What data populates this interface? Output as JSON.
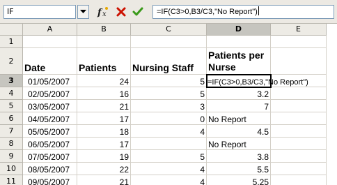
{
  "formula_bar": {
    "name_box": "IF",
    "formula": "=IF(C3>0,B3/C3,\"No Report\")"
  },
  "icons": {
    "fx": "function-wizard-icon",
    "cancel": "cancel-icon",
    "accept": "accept-icon",
    "dropdown": "chevron-down-icon"
  },
  "colors": {
    "header_bg": "#edebe5",
    "header_active_bg": "#c6c5bf",
    "cancel_red": "#cc1100",
    "accept_green": "#3a9a1a"
  },
  "columns": [
    "A",
    "B",
    "C",
    "D",
    "E"
  ],
  "rows": [
    {
      "num": "1",
      "a": "",
      "b": "",
      "c": "",
      "d": "",
      "e": ""
    },
    {
      "num": "2",
      "a": "Date",
      "b": "Patients",
      "c": "Nursing Staff",
      "d": "Patients per Nurse",
      "e": ""
    },
    {
      "num": "3",
      "a": "01/05/2007",
      "b": "24",
      "c": "5",
      "d": "=IF(C3>0,B3/C3,\"No Report\")",
      "e": ""
    },
    {
      "num": "4",
      "a": "02/05/2007",
      "b": "16",
      "c": "5",
      "d": "3.2",
      "e": ""
    },
    {
      "num": "5",
      "a": "03/05/2007",
      "b": "21",
      "c": "3",
      "d": "7",
      "e": ""
    },
    {
      "num": "6",
      "a": "04/05/2007",
      "b": "17",
      "c": "0",
      "d": "No Report",
      "e": ""
    },
    {
      "num": "7",
      "a": "05/05/2007",
      "b": "18",
      "c": "4",
      "d": "4.5",
      "e": ""
    },
    {
      "num": "8",
      "a": "06/05/2007",
      "b": "17",
      "c": "",
      "d": "No Report",
      "e": ""
    },
    {
      "num": "9",
      "a": "07/05/2007",
      "b": "19",
      "c": "5",
      "d": "3.8",
      "e": ""
    },
    {
      "num": "10",
      "a": "08/05/2007",
      "b": "22",
      "d": "5.5",
      "c": "4",
      "e": ""
    },
    {
      "num": "11",
      "a": "09/05/2007",
      "b": "21",
      "c": "4",
      "d": "5.25",
      "e": ""
    }
  ]
}
